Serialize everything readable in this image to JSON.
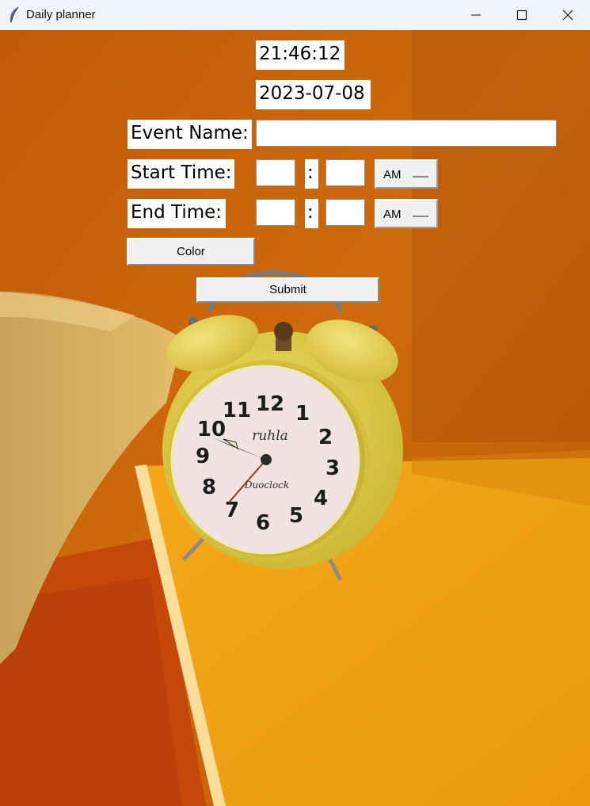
{
  "window": {
    "title": "Daily planner",
    "app_icon": "feather-icon",
    "controls": [
      "minimize-icon",
      "maximize-icon",
      "close-icon"
    ]
  },
  "clock": {
    "time": "21:46:12",
    "date": "2023-07-08"
  },
  "form": {
    "event_name_label": "Event Name:",
    "event_name_value": "",
    "start_time_label": "Start Time:",
    "start_hour": "",
    "start_minute": "",
    "start_separator": ":",
    "start_ampm": "AM",
    "end_time_label": "End Time:",
    "end_hour": "",
    "end_minute": "",
    "end_separator": ":",
    "end_ampm": "AM",
    "color_button": "Color",
    "submit_button": "Submit"
  },
  "background": {
    "subject": "alarm-clock-photo",
    "clock_face_text": "ruhla",
    "clock_face_subtext": "Duoclock",
    "dial_numbers": [
      "12",
      "1",
      "2",
      "3",
      "4",
      "5",
      "6",
      "7",
      "8",
      "9",
      "10",
      "11"
    ],
    "colors": {
      "wall": "#c9620c",
      "book": "#f0a214",
      "clock_body": "#dcc93a",
      "dial": "#f1e3e1"
    }
  }
}
